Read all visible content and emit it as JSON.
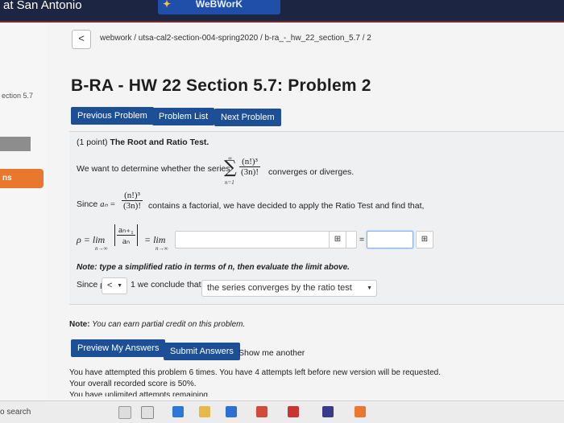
{
  "header": {
    "university": "at San Antonio",
    "logo_text": "WeBWorK"
  },
  "sidebar": {
    "section_label": "ection 5.7",
    "active_item": "ns"
  },
  "breadcrumb": {
    "back_symbol": "<",
    "path": "webwork / utsa-cal2-section-004-spring2020 / b-ra_-_hw_22_section_5.7 / 2"
  },
  "title": "B-RA - HW 22 Section 5.7: Problem 2",
  "nav": {
    "previous": "Previous Problem",
    "list": "Problem List",
    "next": "Next Problem"
  },
  "problem": {
    "points": "(1 point)",
    "heading": "The Root and Ratio Test.",
    "intro_before": "We want to determine whether the series",
    "series_num": "(n!)³",
    "series_den": "(3n)!",
    "sigma_top": "∞",
    "sigma_bottom": "n=1",
    "intro_after": "converges or diverges.",
    "since_label": "Since",
    "an_label": "aₙ =",
    "an_num": "(n!)³",
    "an_den": "(3n)!",
    "since_after": "contains a factorial, we have decided to apply the Ratio Test and find that,",
    "rho_lhs": "ρ = lim",
    "lim_sub": "n→∞",
    "ratio_num": "aₙ₊₁",
    "ratio_den": "aₙ",
    "eq_lim": "= lim",
    "lim_sub2": "n→∞",
    "equals": "=",
    "note": "Note: type a simplified ratio in terms of n, then evaluate the limit above.",
    "conclude_before": "Since ρ",
    "comparison_value": "<",
    "conclude_mid": "1 we conclude that",
    "conclusion_value": "the series converges by the ratio test",
    "mq_icon_label": "⊞"
  },
  "partial_note_label": "Note:",
  "partial_note": "You can earn partial credit on this problem.",
  "actions": {
    "preview": "Preview My Answers",
    "submit": "Submit Answers",
    "show_me": "Show me another"
  },
  "attempts": {
    "line1": "You have attempted this problem 6 times. You have 4 attempts left before new version will be requested.",
    "line2": "Your overall recorded score is 50%.",
    "line3": "You have unlimited attempts remaining."
  },
  "taskbar": {
    "search": "o search"
  },
  "colors": {
    "primary_button": "#1d4f97",
    "header": "#1c2541",
    "orange": "#e9772e"
  }
}
